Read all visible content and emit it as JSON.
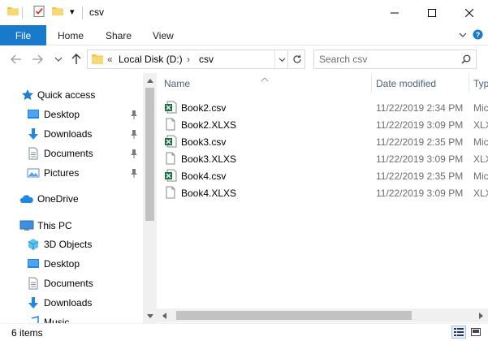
{
  "window": {
    "title": "csv",
    "quick_access_dropdown": "▾"
  },
  "ribbon": {
    "tabs": {
      "file": "File",
      "home": "Home",
      "share": "Share",
      "view": "View"
    }
  },
  "nav": {
    "breadcrumb_overflow": "«",
    "breadcrumb": [
      "Local Disk (D:)",
      "csv"
    ],
    "separator": "›",
    "search_placeholder": "Search csv"
  },
  "sidebar": {
    "quick_access": "Quick access",
    "quick_items": [
      "Desktop",
      "Downloads",
      "Documents",
      "Pictures"
    ],
    "onedrive": "OneDrive",
    "this_pc": "This PC",
    "pc_items": [
      "3D Objects",
      "Desktop",
      "Documents",
      "Downloads",
      "Music"
    ]
  },
  "columns": {
    "name": "Name",
    "date": "Date modified",
    "type": "Type"
  },
  "files": [
    {
      "name": "Book2.csv",
      "date": "11/22/2019 2:34 PM",
      "type": "Microsoft Excel C",
      "kind": "excel"
    },
    {
      "name": "Book2.XLXS",
      "date": "11/22/2019 3:09 PM",
      "type": "XLXS File",
      "kind": "blank"
    },
    {
      "name": "Book3.csv",
      "date": "11/22/2019 2:35 PM",
      "type": "Microsoft Excel C",
      "kind": "excel"
    },
    {
      "name": "Book3.XLXS",
      "date": "11/22/2019 3:09 PM",
      "type": "XLXS File",
      "kind": "blank"
    },
    {
      "name": "Book4.csv",
      "date": "11/22/2019 2:35 PM",
      "type": "Microsoft Excel C",
      "kind": "excel"
    },
    {
      "name": "Book4.XLXS",
      "date": "11/22/2019 3:09 PM",
      "type": "XLXS File",
      "kind": "blank"
    }
  ],
  "status": {
    "item_count": "6 items"
  },
  "colors": {
    "file_tab": "#1979ca",
    "excel_green": "#1e7145",
    "folder_yellow": "#f5c242",
    "header_text": "#4c607a"
  }
}
